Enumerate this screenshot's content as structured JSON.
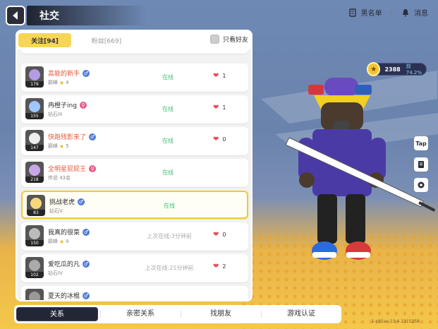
{
  "header": {
    "title": "社交",
    "back_icon": "back-arrow-icon"
  },
  "top_right": {
    "blacklist_label": "黑名单",
    "messages_label": "消息",
    "separator": "/"
  },
  "tabs": {
    "following": "关注[94]",
    "fans": "粉丝[669]",
    "friends_only": "只看好友"
  },
  "friends": [
    {
      "name": "高能的新手",
      "name_color": "#e9573f",
      "gender": "male",
      "rank": "巅峰",
      "stars": "4",
      "level": "179",
      "status": "在线",
      "status_type": "online",
      "likes": "1"
    },
    {
      "name": "冉橙子ing",
      "name_color": "#333333",
      "gender": "female",
      "rank": "钻石III",
      "stars": "",
      "level": "155",
      "status": "在线",
      "status_type": "online",
      "likes": "1"
    },
    {
      "name": "快跑残影来了",
      "name_color": "#e9573f",
      "gender": "male",
      "rank": "巅峰",
      "stars": "5",
      "level": "147",
      "status": "在线",
      "status_type": "online",
      "likes": "0"
    },
    {
      "name": "全明星屁屁王",
      "name_color": "#e9573f",
      "gender": "female",
      "rank": "传说 43名",
      "stars": "",
      "level": "218",
      "status": "在线",
      "status_type": "online",
      "likes": ""
    },
    {
      "name": "挑战老虎",
      "name_color": "#333333",
      "gender": "male",
      "rank": "钻石V",
      "stars": "",
      "level": "83",
      "status": "在线",
      "status_type": "online",
      "likes": ""
    },
    {
      "name": "我真的很菜",
      "name_color": "#333333",
      "gender": "male",
      "rank": "巅峰",
      "stars": "4",
      "level": "150",
      "status": "上次在线:3分钟前",
      "status_type": "offline",
      "likes": "0"
    },
    {
      "name": "爱吃瓜的凡",
      "name_color": "#333333",
      "gender": "male",
      "rank": "钻石IV",
      "stars": "",
      "level": "102",
      "status": "上次在线:21分钟前",
      "status_type": "offline",
      "likes": "2"
    },
    {
      "name": "夏天的冰棍",
      "name_color": "#333333",
      "gender": "male",
      "rank": "",
      "stars": "",
      "level": "",
      "status": "",
      "status_type": "offline",
      "likes": ""
    }
  ],
  "currency": {
    "value": "2388",
    "percent": "前74.2%"
  },
  "side_buttons": {
    "tap": "Tap"
  },
  "bottom_nav": {
    "relations": "关系",
    "intimate": "亲密关系",
    "find_friends": "找朋友",
    "verify": "游戏认证"
  },
  "version": "1-p55ac-13.4.1315258"
}
